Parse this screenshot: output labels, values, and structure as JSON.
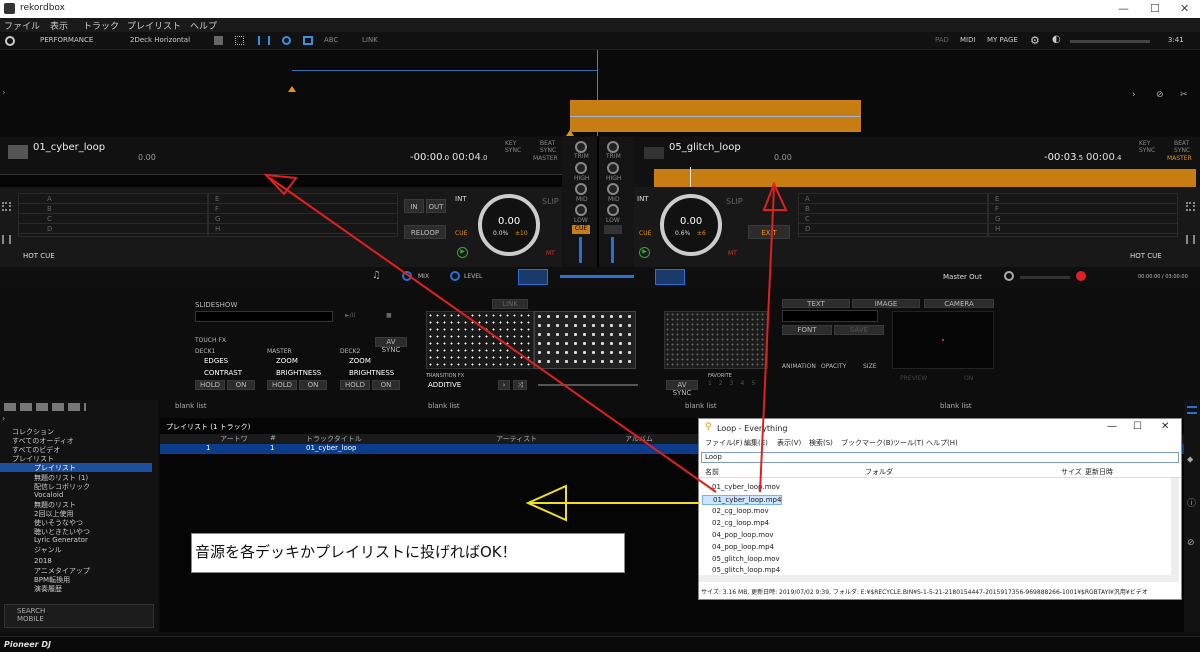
{
  "window": {
    "title": "rekordbox",
    "min": "—",
    "max": "☐",
    "close": "✕"
  },
  "menu": [
    "ファイル",
    "表示",
    "トラック",
    "プレイリスト",
    "ヘルプ"
  ],
  "toolbar": {
    "mode": "PERFORMANCE",
    "layout": "2Deck Horizontal",
    "link": "LINK",
    "pad": "PAD",
    "midi": "MIDI",
    "mypage": "MY PAGE",
    "time": "3:41"
  },
  "deck1": {
    "title": "01_cyber_loop",
    "bpm": "0.00",
    "elapsed": "-00:00",
    "elapsed_ms": ".0",
    "remain": "00:04",
    "remain_ms": ".0",
    "key": "KEY",
    "sync": "SYNC",
    "beat": "BEAT",
    "beat_sync": "SYNC",
    "master": "MASTER",
    "knob": "0.00",
    "pct": "0.0%",
    "range": "±10",
    "int": "INT",
    "slip": "SLIP",
    "cue": "CUE",
    "in": "IN",
    "out": "OUT",
    "reloop": "RELOOP",
    "mt": "MT",
    "hotcue": "HOT CUE",
    "pads_left": [
      "A",
      "B",
      "C",
      "D"
    ],
    "pads_right": [
      "E",
      "F",
      "G",
      "H"
    ]
  },
  "deck2": {
    "title": "05_glitch_loop",
    "bpm": "0.00",
    "elapsed": "-00:03",
    "elapsed_ms": ".5",
    "remain": "00:00",
    "remain_ms": ".4",
    "key": "KEY",
    "sync": "SYNC",
    "beat": "BEAT",
    "beat_sync": "SYNC",
    "master": "MASTER",
    "knob": "0.00",
    "pct": "0.6%",
    "range": "±6",
    "int": "INT",
    "slip": "SLIP",
    "cue": "CUE",
    "exit": "EXIT",
    "mt": "MT",
    "hotcue": "HOT CUE",
    "pads_left": [
      "A",
      "B",
      "C",
      "D"
    ],
    "pads_right": [
      "E",
      "F",
      "G",
      "H"
    ]
  },
  "mixer": {
    "trim": "TRIM",
    "high": "HIGH",
    "mid": "MID",
    "low": "LOW",
    "cue": "CUE"
  },
  "fxbar": {
    "mix": "MIX",
    "level": "LEVEL",
    "master_out": "Master Out",
    "rec_time": "00:00:00 / 03:00:00"
  },
  "video": {
    "slideshow": "SLIDESHOW",
    "touch_fx": "TOUCH FX",
    "av_sync": "AV SYNC",
    "deck1": "DECK1",
    "master": "MASTER",
    "deck2": "DECK2",
    "x_edges": "EDGES",
    "y_contrast": "CONTRAST",
    "x_zoom": "ZOOM",
    "y_brightness": "BRIGHTNESS",
    "x_zoom2": "ZOOM",
    "y_brightness2": "BRIGHTNESS",
    "hold": "HOLD",
    "on": "ON",
    "transition_fx": "TRANSITION FX",
    "additive": "ADDITIVE",
    "av_sync2": "AV SYNC",
    "favorite": "FAVORITE",
    "fav_nums": [
      "1",
      "2",
      "3",
      "4",
      "5"
    ],
    "link": "LINK",
    "text": "TEXT",
    "image": "IMAGE",
    "camera": "CAMERA",
    "font": "FONT",
    "save": "SAVE",
    "animation": "ANIMATION",
    "opacity": "OPACITY",
    "size": "SIZE",
    "preview": "PREVIEW",
    "on2": "ON"
  },
  "sidebar": {
    "items": [
      "コレクション",
      "すべてのオーディオ",
      "すべてのビデオ",
      "プレイリスト",
      "プレイリスト",
      "無題のリスト (1)",
      "配信レコポリック",
      "Vocaloid",
      "無題のリスト",
      "2回以上使用",
      "使いそうなやつ",
      "聴いときたいやつ",
      "Lyric Generator",
      "ジャンル",
      "2018",
      "アニメタイアップ",
      "BPM転換用",
      "演奏履歴"
    ],
    "search": "SEARCH",
    "mobile": "MOBILE"
  },
  "blanklists": [
    "blank list",
    "blank list",
    "blank list",
    "blank list"
  ],
  "playlist": {
    "title": "プレイリスト (1 トラック)",
    "cols": [
      "アートワ",
      "#",
      "トラックタイトル",
      "アーティスト",
      "アルバム"
    ],
    "row": {
      "num": "1",
      "title": "01_cyber_loop",
      "idx": "1"
    }
  },
  "annotation": "音源を各デッキかプレイリストに投げればOK！",
  "everything": {
    "title": "Loop - Everything",
    "menu": [
      "ファイル(F)",
      "編集(E)",
      "表示(V)",
      "検索(S)",
      "ブックマーク(B)",
      "ツール(T)",
      "ヘルプ(H)"
    ],
    "search": "Loop",
    "cols": [
      "名前",
      "フォルダ",
      "サイズ",
      "更新日時"
    ],
    "files": [
      "01_cyber_loop.mov",
      "01_cyber_loop.mp4",
      "02_cg_loop.mov",
      "02_cg_loop.mp4",
      "04_pop_loop.mov",
      "04_pop_loop.mp4",
      "05_glitch_loop.mov",
      "05_glitch_loop.mp4"
    ],
    "status": "サイズ: 3.16 MB, 更新日時: 2019/07/02 9:39, フォルダ: E:¥$RECYCLE.BIN¥S-1-5-21-2180154447-2015917356-969888266-1001¥$RGBTAYI¥汎用¥ビデオ"
  },
  "brand": "Pioneer DJ",
  "colors": {
    "accent": "#e8920a",
    "blue": "#2a6fd6",
    "annotation_red": "#e02020",
    "annotation_yellow": "#f0e020"
  }
}
